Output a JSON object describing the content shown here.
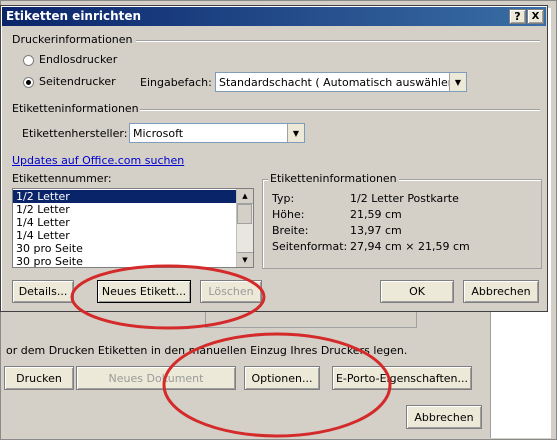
{
  "dialog": {
    "title": "Etiketten einrichten",
    "help_btn": "?",
    "close_btn": "X"
  },
  "printer": {
    "group": "Druckerinformationen",
    "option_continuous": "Endlosdrucker",
    "option_page": "Seitendrucker",
    "selected": "Seitendrucker",
    "tray_label": "Eingabefach:",
    "tray_value": "Standardschacht ( Automatisch auswählen)"
  },
  "label_info": {
    "group": "Etiketteninformationen",
    "vendor_label": "Etikettenhersteller:",
    "vendor_value": "Microsoft",
    "updates_link": "Updates auf Office.com suchen",
    "number_label": "Etikettennummer:",
    "numbers": [
      "1/2 Letter",
      "1/2 Letter",
      "1/4 Letter",
      "1/4 Letter",
      "30 pro Seite",
      "30 pro Seite"
    ],
    "selected_index": 0
  },
  "details": {
    "group": "Etiketteninformationen",
    "rows": [
      {
        "k": "Typ:",
        "v": "1/2 Letter Postkarte"
      },
      {
        "k": "Höhe:",
        "v": "21,59 cm"
      },
      {
        "k": "Breite:",
        "v": "13,97 cm"
      },
      {
        "k": "Seitenformat:",
        "v": "27,94 cm × 21,59 cm"
      }
    ]
  },
  "buttons": {
    "details": "Details...",
    "new_label": "Neues Etikett...",
    "delete": "Löschen",
    "ok": "OK",
    "cancel": "Abbrechen"
  },
  "background": {
    "note": "or dem Drucken Etiketten in den manuellen Einzug Ihres Druckers legen.",
    "print": "Drucken",
    "new_doc": "Neues Dokument",
    "options": "Optionen...",
    "eporto": "E-Porto-Eigenschaften...",
    "cancel": "Abbrechen"
  },
  "colors": {
    "titlebar": "#0a246a",
    "highlight": "#d42a2a",
    "link": "#0000cc"
  }
}
